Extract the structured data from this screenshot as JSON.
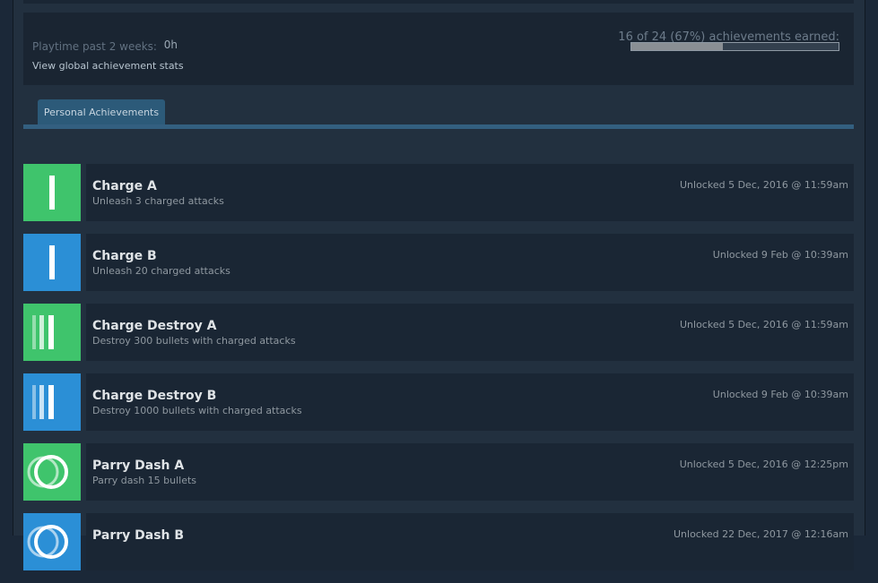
{
  "colors": {
    "green": "#3fc46c",
    "blue": "#2b8fd6"
  },
  "stats": {
    "playtime_label": "Playtime past 2 weeks:",
    "playtime_value": "0h",
    "global_stats_link": "View global achievement stats",
    "earned_text": "16 of 24 (67%) achievements earned:",
    "earned_fraction": 0.67
  },
  "tabs": [
    {
      "label": "Personal Achievements"
    }
  ],
  "achievements": [
    {
      "name": "Charge A",
      "description": "Unleash 3 charged attacks",
      "unlocked": "Unlocked 5 Dec, 2016 @ 11:59am",
      "icon": "single-bar-icon",
      "color": "green"
    },
    {
      "name": "Charge B",
      "description": "Unleash 20 charged attacks",
      "unlocked": "Unlocked 9 Feb @ 10:39am",
      "icon": "single-bar-icon",
      "color": "blue"
    },
    {
      "name": "Charge Destroy A",
      "description": "Destroy 300 bullets with charged attacks",
      "unlocked": "Unlocked 5 Dec, 2016 @ 11:59am",
      "icon": "triple-bar-icon",
      "color": "green"
    },
    {
      "name": "Charge Destroy B",
      "description": "Destroy 1000 bullets with charged attacks",
      "unlocked": "Unlocked 9 Feb @ 10:39am",
      "icon": "triple-bar-icon",
      "color": "blue"
    },
    {
      "name": "Parry Dash A",
      "description": "Parry dash 15 bullets",
      "unlocked": "Unlocked 5 Dec, 2016 @ 12:25pm",
      "icon": "double-ring-icon",
      "color": "green"
    },
    {
      "name": "Parry Dash B",
      "description": "",
      "unlocked": "Unlocked 22 Dec, 2017 @ 12:16am",
      "icon": "double-ring-icon",
      "color": "blue"
    }
  ]
}
